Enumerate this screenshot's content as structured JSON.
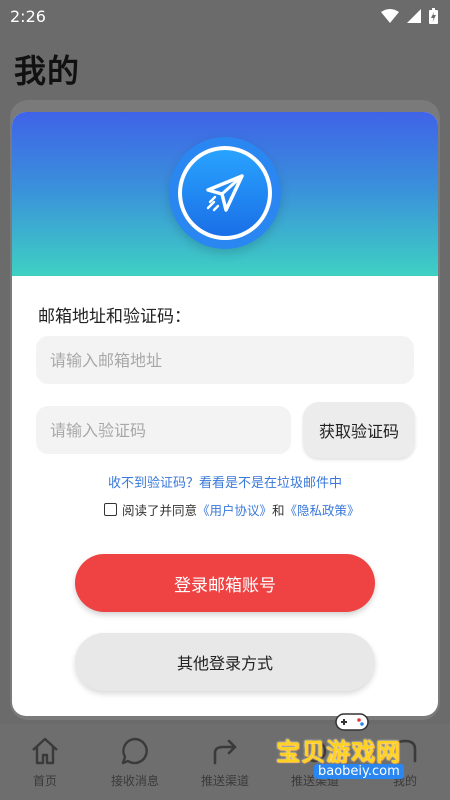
{
  "status_bar": {
    "time": "2:26"
  },
  "page": {
    "title": "我的"
  },
  "modal": {
    "form_label": "邮箱地址和验证码：",
    "email_placeholder": "请输入邮箱地址",
    "code_placeholder": "请输入验证码",
    "get_code_label": "获取验证码",
    "spam_hint": "收不到验证码？看看是不是在垃圾邮件中",
    "agree_prefix": "阅读了并同意",
    "user_agreement": "《用户协议》",
    "and_text": "和",
    "privacy_policy": "《隐私政策》",
    "agreed": false,
    "login_label": "登录邮箱账号",
    "other_login_label": "其他登录方式"
  },
  "bottom_nav": {
    "items": [
      {
        "label": "首页",
        "icon": "home-icon"
      },
      {
        "label": "接收消息",
        "icon": "message-icon"
      },
      {
        "label": "推送渠道",
        "icon": "share-icon"
      },
      {
        "label": "推送渠道",
        "icon": "channel-icon"
      },
      {
        "label": "我的",
        "icon": "profile-icon"
      }
    ]
  },
  "watermark": {
    "text": "宝贝游戏网",
    "url": "baobeiy.com"
  },
  "colors": {
    "accent_red": "#ef4242",
    "link_blue": "#3a79d9",
    "header_top": "#3f63e8",
    "header_bottom": "#3ed0c3"
  }
}
